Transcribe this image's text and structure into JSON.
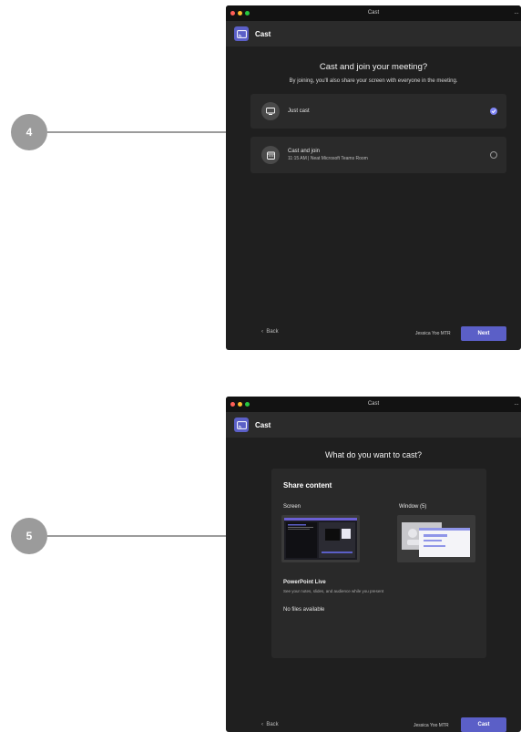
{
  "callouts": [
    {
      "number": "4"
    },
    {
      "number": "5"
    }
  ],
  "colors": {
    "window_bg": "#1f1f1f",
    "accent": "#5b5fc7",
    "radio_checked": "#7f85f5",
    "traffic_red": "#ff5f57",
    "traffic_yellow": "#febc2e",
    "traffic_green": "#28c840"
  },
  "window4": {
    "title": "Cast",
    "app_title": "Cast",
    "app_icon": "cast-icon",
    "heading": "Cast and join your meeting?",
    "subheading": "By joining, you'll also share your screen with everyone in the meeting.",
    "options": [
      {
        "label": "Just cast",
        "icon": "monitor-icon",
        "selected": true
      },
      {
        "label": "Cast and join",
        "sublabel": "11:15 AM | Neat Microsoft Teams Room",
        "icon": "calendar-icon",
        "selected": false
      }
    ],
    "back_label": "Back",
    "user_name": "Jessica Yoo MTR",
    "primary_label": "Next"
  },
  "window5": {
    "title": "Cast",
    "app_title": "Cast",
    "app_icon": "cast-icon",
    "heading": "What do you want to cast?",
    "panel_title": "Share content",
    "screen_label": "Screen",
    "window_label": "Window (5)",
    "ppt_title": "PowerPoint Live",
    "ppt_desc": "See your notes, slides, and audience while you present",
    "no_files": "No files available",
    "back_label": "Back",
    "user_name": "Jessica Yoo MTR",
    "primary_label": "Cast"
  }
}
